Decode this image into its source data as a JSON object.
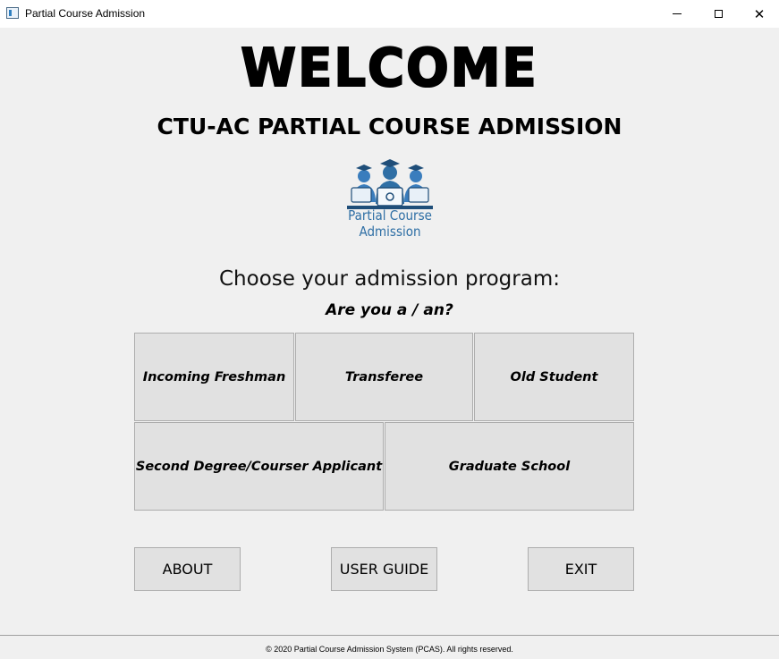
{
  "window": {
    "title": "Partial Course Admission",
    "controls": [
      "minimize-icon",
      "maximize-icon",
      "close-icon"
    ],
    "close_glyph": "✕"
  },
  "header": {
    "welcome": "WELCOME",
    "subtitle": "CTU-AC PARTIAL COURSE ADMISSION",
    "logo_text": "Partial Course Admission"
  },
  "main": {
    "prompt": "Choose your admission program:",
    "question": "Are you a / an?",
    "options": [
      "Incoming Freshman",
      "Transferee",
      "Old Student",
      "Second Degree/Courser Applicant",
      "Graduate School"
    ]
  },
  "buttons": {
    "about": "ABOUT",
    "user_guide": "USER GUIDE",
    "exit": "EXIT"
  },
  "footer": {
    "copyright": "© 2020 Partial Course Admission System (PCAS). All rights reserved."
  },
  "colors": {
    "logo_blue": "#2f6fa5",
    "button_bg": "#e1e1e1",
    "window_bg": "#f0f0f0"
  }
}
